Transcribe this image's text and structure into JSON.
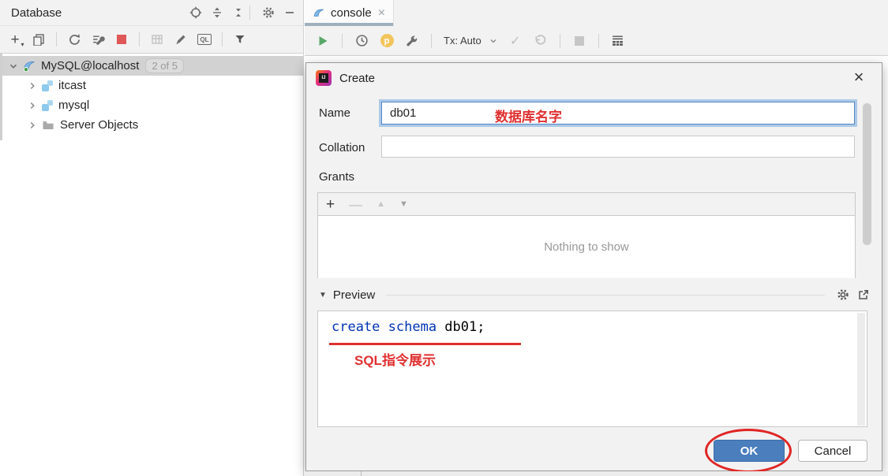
{
  "colors": {
    "accent_blue": "#4a7ebd",
    "annotation_red": "#e03030",
    "keyword_blue": "#0033b3",
    "play_green": "#59a869",
    "stop_red": "#e05757",
    "param_orange": "#f2c55c",
    "tab_underline": "#9fb0bd",
    "tree_selection": "#d2d2d2"
  },
  "database_panel": {
    "title": "Database",
    "toolbar": {
      "ql_icon_label": "QL"
    },
    "tree": {
      "connection_label": "MySQL@localhost",
      "connection_badge": "2 of 5",
      "items": [
        {
          "label": "itcast"
        },
        {
          "label": "mysql"
        },
        {
          "label": "Server Objects"
        }
      ]
    }
  },
  "console_panel": {
    "tab_label": "console",
    "tab_close": "×",
    "tx_label": "Tx: Auto",
    "param_icon_letter": "p"
  },
  "dialog": {
    "title": "Create",
    "close": "×",
    "name_label": "Name",
    "name_value": "db01",
    "collation_label": "Collation",
    "collation_value": "",
    "grants_label": "Grants",
    "empty_text": "Nothing to show",
    "preview_label": "Preview",
    "sql_keyword": "create schema",
    "sql_rest": " db01;",
    "ok_label": "OK",
    "cancel_label": "Cancel"
  },
  "annotations": {
    "name_note": "数据库名字",
    "sql_note": "SQL指令展示"
  }
}
